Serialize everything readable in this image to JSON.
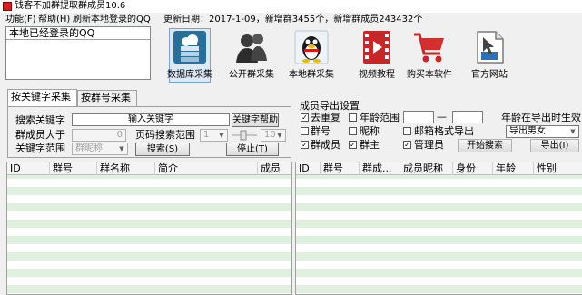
{
  "window": {
    "title": "钱客不加群提取群成员10.6"
  },
  "menu": {
    "items": [
      "功能(F)",
      "帮助(H)",
      "刷新本地登录的QQ"
    ]
  },
  "status": {
    "text": "更新日期：2017-1-09，新增群3455个，新增群成员243432个"
  },
  "qq_panel": {
    "header": "本地已经登录的QQ"
  },
  "toolbar": {
    "items": [
      {
        "label": "数据库采集",
        "icon": "database-cloud-icon"
      },
      {
        "label": "公开群采集",
        "icon": "people-icon"
      },
      {
        "label": "本地群采集",
        "icon": "qq-penguin-icon"
      },
      {
        "label": "视频教程",
        "icon": "video-film-icon"
      },
      {
        "label": "购买本软件",
        "icon": "shopping-cart-icon"
      },
      {
        "label": "官方网站",
        "icon": "website-cursor-icon"
      }
    ]
  },
  "tabs": [
    {
      "label": "按关键字采集"
    },
    {
      "label": "按群号采集"
    }
  ],
  "keyword": {
    "search_label": "搜索关键字",
    "search_value": "输入关键字",
    "help_button": "关键字帮助",
    "min_members_label": "群成员大于",
    "min_members_value": "0",
    "page_range_label": "页码搜索范围",
    "page_from": "1",
    "page_to": "10",
    "scope_label": "关键字范围",
    "scope_value": "群昵称",
    "search_button": "搜索(S)",
    "stop_button": "停止(T)"
  },
  "export": {
    "group_title": "成员导出设置",
    "dedupe_label": "去重复",
    "age_range_label": "年龄范围",
    "range_dash": "—",
    "age_export_label": "年龄在导出时生效",
    "group_no_label": "群号",
    "nickname_label": "昵称",
    "email_format_label": "邮箱格式导出",
    "gender_value": "导出男女",
    "members_label": "群成员",
    "owner_label": "群主",
    "admin_label": "管理员",
    "start_search_button": "开始搜索",
    "export_button": "导出(I)",
    "checked": {
      "dedupe": true,
      "age_range": false,
      "group_no": false,
      "nickname": false,
      "email_format": false,
      "members": true,
      "owner": true,
      "admin": true
    }
  },
  "left_table": {
    "columns": [
      "ID",
      "群号",
      "群名称",
      "简介",
      "成员"
    ]
  },
  "right_table": {
    "columns": [
      "ID",
      "群号",
      "群成...",
      "成员昵称",
      "身份",
      "年龄",
      "性别"
    ]
  }
}
